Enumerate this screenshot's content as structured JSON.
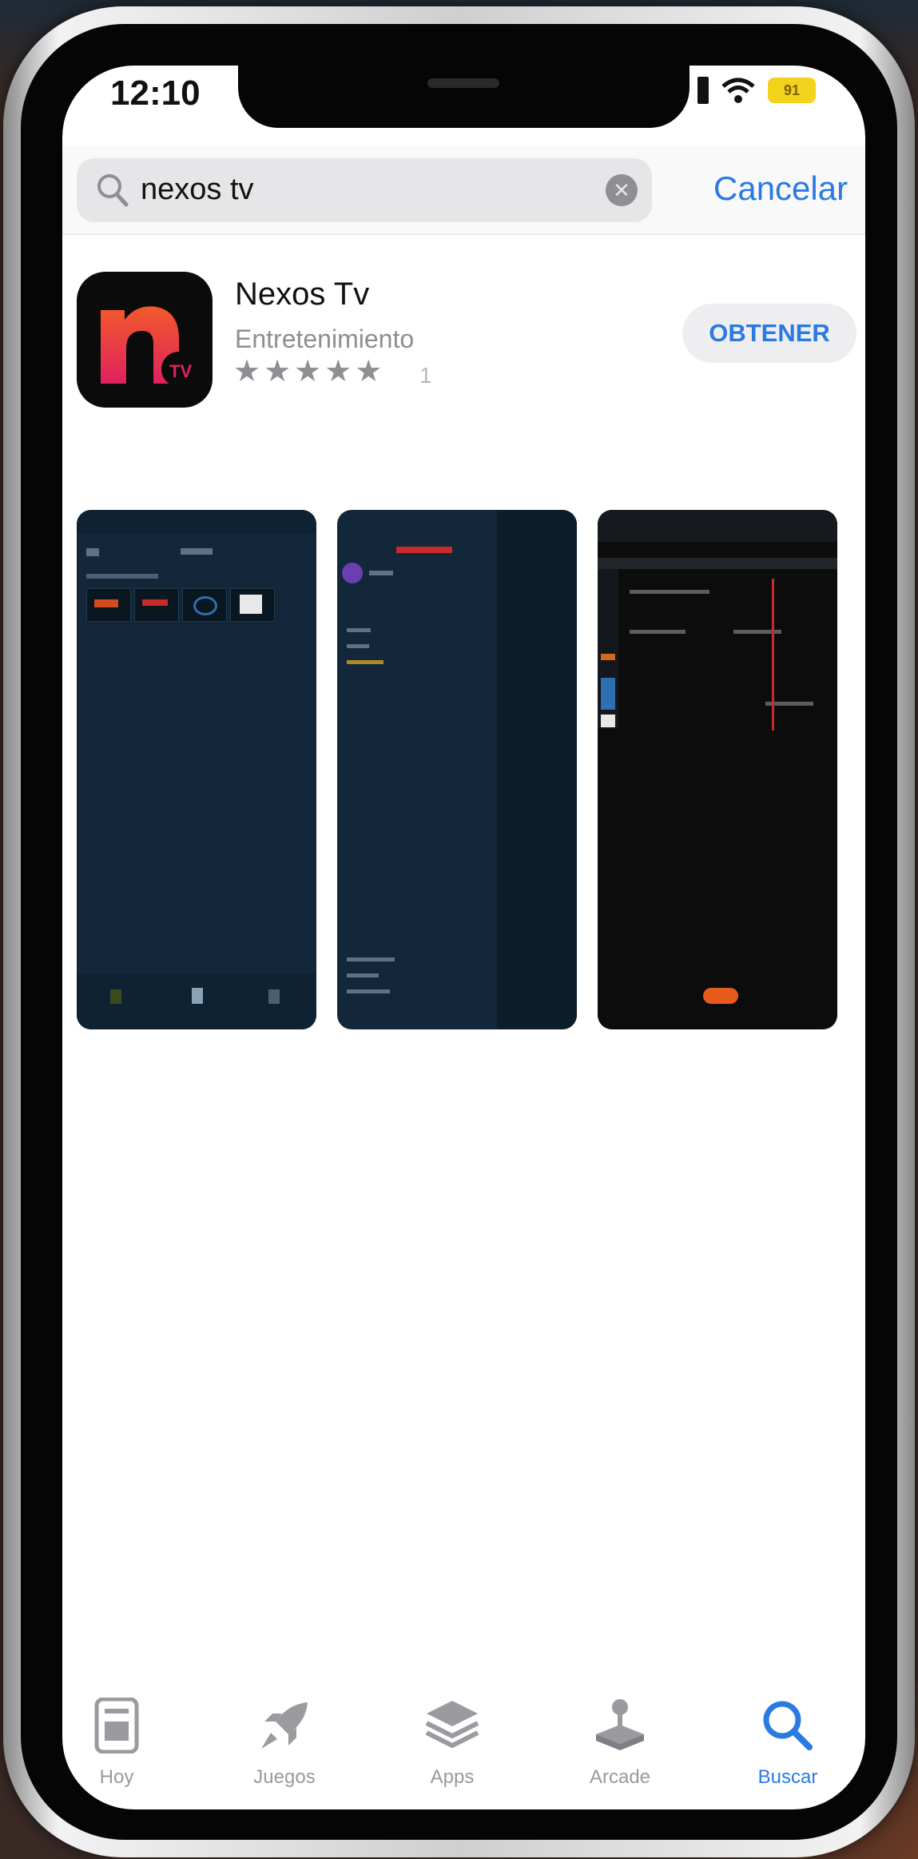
{
  "status": {
    "time": "12:10",
    "battery": "91"
  },
  "search": {
    "query": "nexos tv",
    "cancel_label": "Cancelar"
  },
  "result": {
    "name": "Nexos Tv",
    "category": "Entretenimiento",
    "stars": "★★★★★",
    "rating_count": "1",
    "get_label": "OBTENER",
    "icon": {
      "letter": "n",
      "badge": "TV",
      "colors": [
        "#f25a2a",
        "#e0215e"
      ]
    }
  },
  "tabs": [
    {
      "label": "Hoy",
      "icon": "today-icon"
    },
    {
      "label": "Juegos",
      "icon": "rocket-icon"
    },
    {
      "label": "Apps",
      "icon": "apps-stack-icon"
    },
    {
      "label": "Arcade",
      "icon": "joystick-icon"
    },
    {
      "label": "Buscar",
      "icon": "search-icon",
      "active": true
    }
  ],
  "colors": {
    "accent": "#2a7ae2",
    "screenshot_bg": "#12283a"
  }
}
